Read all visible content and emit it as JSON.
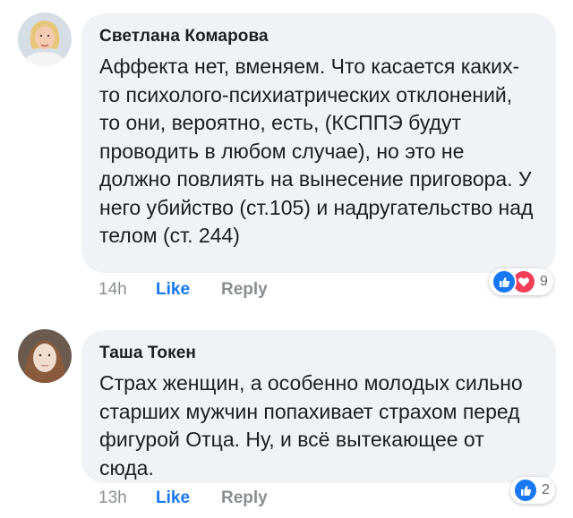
{
  "comments": [
    {
      "author": "Светлана Комарова",
      "text": "Аффекта нет, вменяем. Что касается каких-то психолого-психиатрических отклонений, то они, вероятно, есть, (КСППЭ будут проводить в любом случае), но это не должно повлиять на вынесение приговора. У него убийство (ст.105) и надругательство над телом (ст. 244)",
      "time": "14h",
      "like_label": "Like",
      "reply_label": "Reply",
      "reaction_count": "9",
      "reactions": [
        "like-icon",
        "love-icon"
      ]
    },
    {
      "author": "Таша Токен",
      "text": "Страх женщин, а особенно молодых сильно старших мужчин попахивает страхом перед фигурой Отца. Ну, и всё вытекающее от сюда.",
      "time": "13h",
      "like_label": "Like",
      "reply_label": "Reply",
      "reaction_count": "2",
      "reactions": [
        "like-icon"
      ]
    }
  ],
  "colors": {
    "bubble": "#f0f2f5",
    "like_blue": "#1877f2",
    "love_red": "#f33e58",
    "meta_gray": "#8a8d91"
  }
}
